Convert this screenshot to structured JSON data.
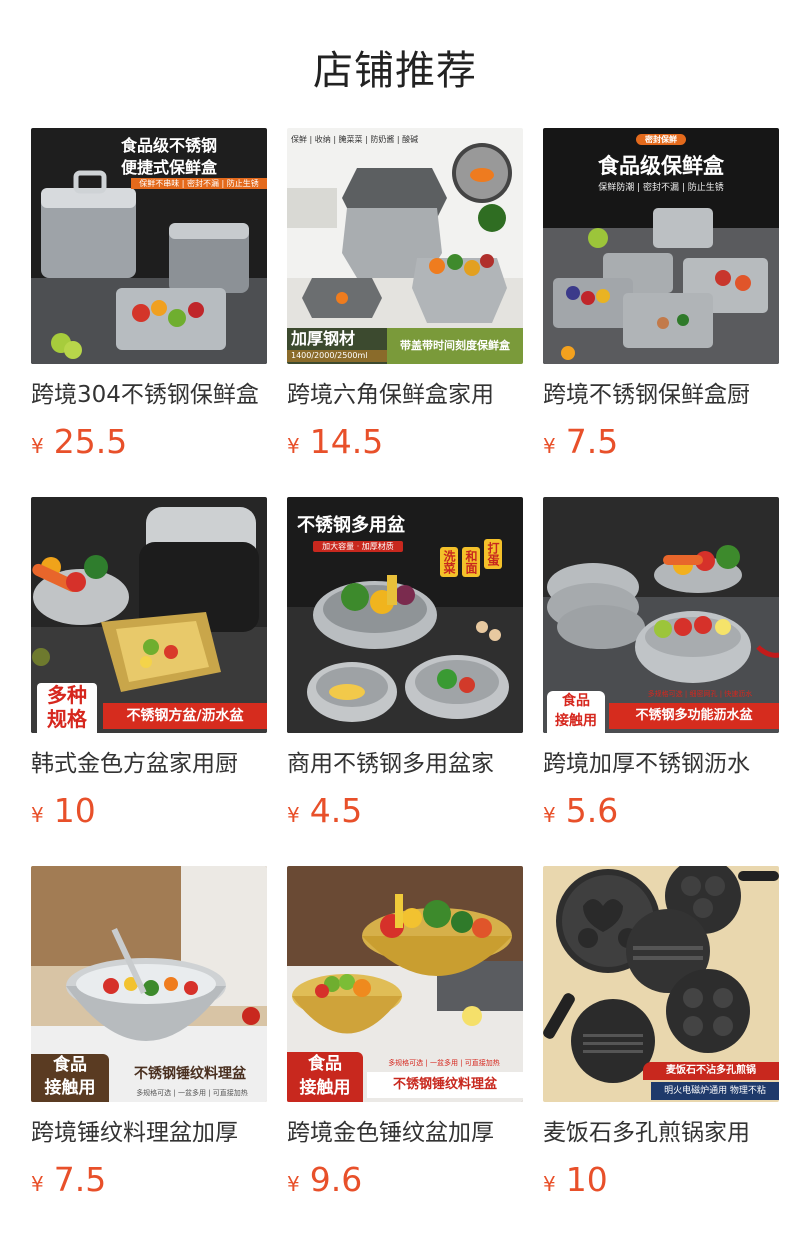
{
  "header": {
    "title": "店铺推荐"
  },
  "currency_symbol": "¥",
  "products": [
    {
      "title": "跨境304不锈钢保鲜盒",
      "price": "25.5",
      "image_text": {
        "headline1": "食品级不锈钢",
        "headline2": "便捷式保鲜盒",
        "tagline": "保鲜不串味 | 密封不漏 | 防止生锈"
      }
    },
    {
      "title": "跨境六角保鲜盒家用",
      "price": "14.5",
      "image_text": {
        "topline": "保鲜 | 收纳 | 腌菜菜 | 防奶酱 | 酸碱",
        "badge": "加厚钢材",
        "sizes": "1400/2000/2500ml",
        "banner": "带盖带时间刻度保鲜盒"
      }
    },
    {
      "title": "跨境不锈钢保鲜盒厨",
      "price": "7.5",
      "image_text": {
        "pill": "密封保鲜",
        "headline": "食品级保鲜盒",
        "tagline": "保鲜防潮 | 密封不漏 | 防止生锈"
      }
    },
    {
      "title": "韩式金色方盆家用厨",
      "price": "10",
      "image_text": {
        "badge1": "多种",
        "badge2": "规格",
        "banner": "不锈钢方盆/沥水盆"
      }
    },
    {
      "title": "商用不锈钢多用盆家",
      "price": "4.5",
      "image_text": {
        "headline": "不锈钢多用盆",
        "sub": "加大容量 · 加厚材质",
        "tag1": "洗菜",
        "tag2": "和面",
        "tag3": "打蛋"
      }
    },
    {
      "title": "跨境加厚不锈钢沥水",
      "price": "5.6",
      "image_text": {
        "topline": "多规格可选 | 细密网孔 | 快速沥水",
        "badge1": "食品",
        "badge2": "接触用",
        "banner": "不锈钢多功能沥水盆"
      }
    },
    {
      "title": "跨境锤纹料理盆加厚",
      "price": "7.5",
      "image_text": {
        "badge1": "食品",
        "badge2": "接触用",
        "banner": "不锈钢锤纹料理盆",
        "topline": "多规格可选 | 一盆多用 | 可直接加热"
      }
    },
    {
      "title": "跨境金色锤纹盆加厚",
      "price": "9.6",
      "image_text": {
        "topline": "多规格可选 | 一盆多用 | 可直接加热",
        "badge1": "食品",
        "badge2": "接触用",
        "banner": "不锈钢锤纹料理盆"
      }
    },
    {
      "title": "麦饭石多孔煎锅家用",
      "price": "10",
      "image_text": {
        "banner1": "麦饭石不沾多孔煎锅",
        "banner2": "明火电磁炉通用 物理不粘"
      }
    }
  ]
}
